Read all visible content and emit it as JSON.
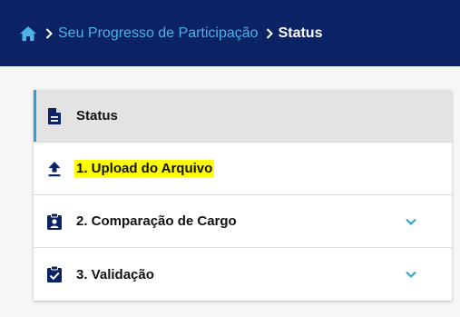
{
  "colors": {
    "header_bg": "#0b2265",
    "link": "#4db2e6",
    "icon": "#0b2265",
    "active_bar": "#2aa2d5",
    "highlight": "#ffff00",
    "chevron": "#2aa2d5"
  },
  "breadcrumb": {
    "home_icon": "home-icon",
    "items": [
      {
        "label": "Seu Progresso de Participação"
      },
      {
        "label": "Status"
      }
    ]
  },
  "menu": {
    "items": [
      {
        "label": "Status",
        "icon": "document-icon",
        "active": true,
        "expandable": false
      },
      {
        "label": "1. Upload do Arquivo",
        "icon": "upload-icon",
        "active": false,
        "expandable": false,
        "highlighted": true
      },
      {
        "label": "2. Comparação de Cargo",
        "icon": "clipboard-user-icon",
        "active": false,
        "expandable": true
      },
      {
        "label": "3. Validação",
        "icon": "clipboard-check-icon",
        "active": false,
        "expandable": true
      }
    ]
  }
}
